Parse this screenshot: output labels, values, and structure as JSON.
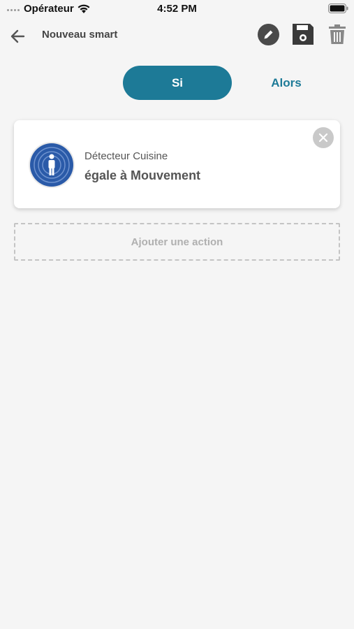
{
  "status_bar": {
    "carrier": "Opérateur",
    "time": "4:52 PM"
  },
  "header": {
    "title": "Nouveau smart",
    "icons": [
      "back-arrow-icon",
      "edit-icon",
      "save-icon",
      "trash-icon"
    ]
  },
  "tabs": [
    {
      "label": "Si",
      "active": true
    },
    {
      "label": "Alors",
      "active": false
    }
  ],
  "condition": {
    "device": "Détecteur Cuisine",
    "text": "égale à Mouvement",
    "icon": "motion-detector-icon"
  },
  "add_action": {
    "label": "Ajouter une action"
  },
  "colors": {
    "accent": "#1d7a97",
    "background": "#f5f5f5",
    "icon_blue": "#2a5aa8"
  }
}
